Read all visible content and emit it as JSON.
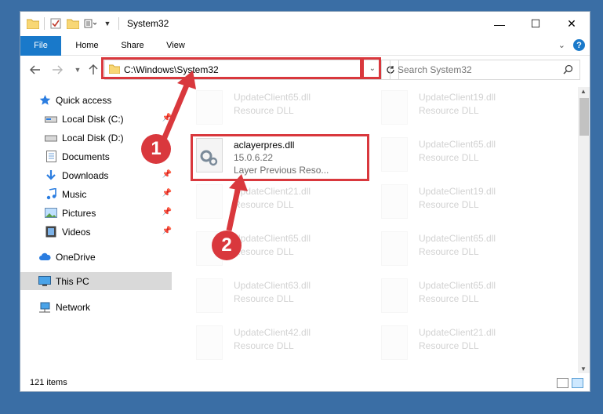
{
  "window": {
    "title": "System32",
    "controls": {
      "minimize": "—",
      "maximize": "☐",
      "close": "✕"
    }
  },
  "ribbon": {
    "tabs": [
      {
        "label": "File",
        "active": true
      },
      {
        "label": "Home"
      },
      {
        "label": "Share"
      },
      {
        "label": "View"
      }
    ]
  },
  "nav": {
    "address": "C:\\Windows\\System32",
    "search_placeholder": "Search System32"
  },
  "sidebar": {
    "items": [
      {
        "label": "Quick access",
        "icon": "star-icon",
        "pinned": false
      },
      {
        "label": "Local Disk (C:)",
        "icon": "drive-icon",
        "pinned": true
      },
      {
        "label": "Local Disk (D:)",
        "icon": "drive-icon",
        "pinned": false
      },
      {
        "label": "Documents",
        "icon": "documents-icon",
        "pinned": false
      },
      {
        "label": "Downloads",
        "icon": "downloads-icon",
        "pinned": true
      },
      {
        "label": "Music",
        "icon": "music-icon",
        "pinned": true
      },
      {
        "label": "Pictures",
        "icon": "pictures-icon",
        "pinned": true
      },
      {
        "label": "Videos",
        "icon": "videos-icon",
        "pinned": true
      },
      {
        "label": "OneDrive",
        "icon": "cloud-icon",
        "pinned": false
      },
      {
        "label": "This PC",
        "icon": "computer-icon",
        "pinned": false,
        "selected": true
      },
      {
        "label": "Network",
        "icon": "network-icon",
        "pinned": false
      }
    ]
  },
  "files": {
    "highlighted": {
      "name": "aclayerpres.dll",
      "version": "15.0.6.22",
      "description": "Layer Previous Reso..."
    },
    "col1": [
      {
        "name": "UpdateClient65.dll",
        "sub": "Resource DLL"
      },
      {
        "name": "UpdateClient21.dll",
        "sub": "Resource DLL"
      },
      {
        "name": "UpdateClient65.dll",
        "sub": "Resource DLL"
      },
      {
        "name": "UpdateClient63.dll",
        "sub": "Resource DLL"
      },
      {
        "name": "UpdateClient42.dll",
        "sub": "Resource DLL"
      }
    ],
    "col2": [
      {
        "name": "UpdateClient19.dll",
        "sub": "Resource DLL"
      },
      {
        "name": "UpdateClient65.dll",
        "sub": "Resource DLL"
      },
      {
        "name": "UpdateClient19.dll",
        "sub": "Resource DLL"
      },
      {
        "name": "UpdateClient65.dll",
        "sub": "Resource DLL"
      },
      {
        "name": "UpdateClient65.dll",
        "sub": "Resource DLL"
      },
      {
        "name": "UpdateClient21.dll",
        "sub": "Resource DLL"
      }
    ]
  },
  "status": {
    "item_count": "121 items"
  },
  "annotations": {
    "step1": "1",
    "step2": "2"
  },
  "colors": {
    "accent": "#1979ca",
    "annotation_red": "#d9383d"
  }
}
